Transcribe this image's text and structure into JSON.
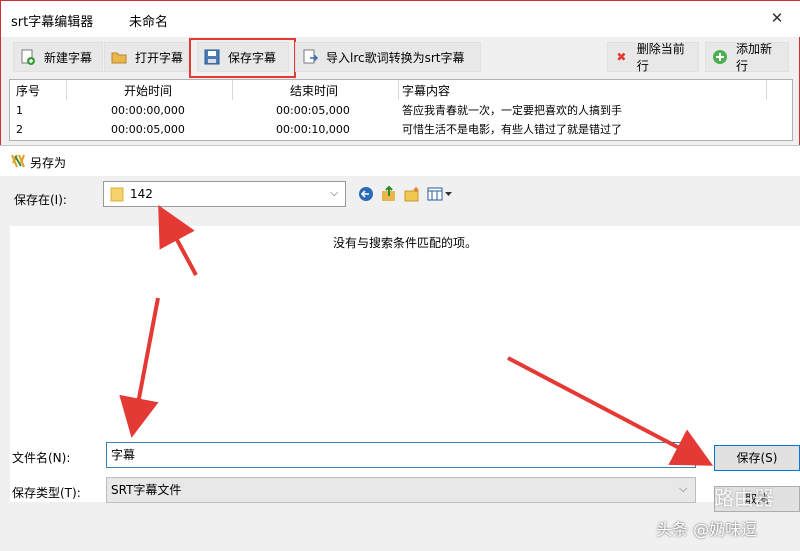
{
  "app": {
    "title": "srt字幕编辑器",
    "document": "未命名",
    "toolbar": {
      "new": "新建字幕",
      "open": "打开字幕",
      "save": "保存字幕",
      "import": "导入lrc歌词转换为srt字幕",
      "delete": "删除当前行",
      "add": "添加新行"
    },
    "table": {
      "headers": [
        "序号",
        "开始时间",
        "结束时间",
        "字幕内容"
      ],
      "rows": [
        [
          "1",
          "00:00:00,000",
          "00:00:05,000",
          "答应我青春就一次，一定要把喜欢的人搞到手"
        ],
        [
          "2",
          "00:00:05,000",
          "00:00:10,000",
          "可惜生活不是电影，有些人错过了就是错过了"
        ]
      ]
    }
  },
  "dialog": {
    "title": "另存为",
    "save_in_label": "保存在(I):",
    "folder": "142",
    "empty_message": "没有与搜索条件匹配的项。",
    "filename_label": "文件名(N):",
    "filename_value": "字幕",
    "filetype_label": "保存类型(T):",
    "filetype_value": "SRT字幕文件",
    "save_button": "保存(S)",
    "cancel_button": "取消"
  },
  "watermark": "头条 @奶味逗",
  "router_watermark": "路由器",
  "colors": {
    "highlight": "#e53935",
    "arrow": "#e53935",
    "focus": "#0078d7"
  }
}
